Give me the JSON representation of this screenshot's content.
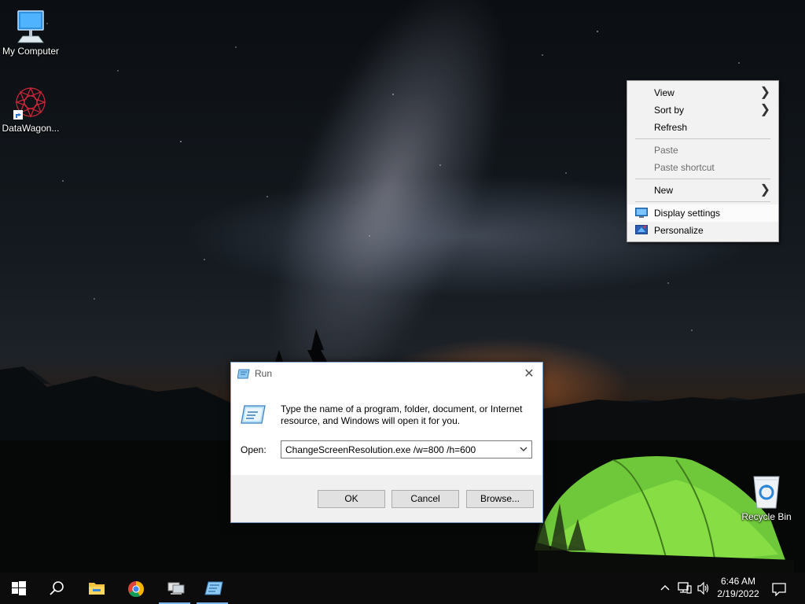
{
  "desktop": {
    "icons": [
      {
        "label": "My Computer",
        "icon": "computer-icon"
      },
      {
        "label": "DataWagon...",
        "icon": "datawagon-icon"
      },
      {
        "label": "Recycle Bin",
        "icon": "recycle-bin-icon"
      }
    ]
  },
  "context_menu": {
    "items": [
      {
        "label": "View",
        "submenu": true
      },
      {
        "label": "Sort by",
        "submenu": true
      },
      {
        "label": "Refresh"
      },
      {
        "label": "Paste",
        "disabled": true
      },
      {
        "label": "Paste shortcut",
        "disabled": true
      },
      {
        "label": "New",
        "submenu": true
      },
      {
        "label": "Display settings",
        "icon": "display-icon",
        "highlighted": true
      },
      {
        "label": "Personalize",
        "icon": "personalize-icon"
      }
    ]
  },
  "run_dialog": {
    "title": "Run",
    "close_glyph": "✕",
    "description": "Type the name of a program, folder, document, or Internet resource, and Windows will open it for you.",
    "open_label": "Open:",
    "open_value": "ChangeScreenResolution.exe /w=800 /h=600",
    "ok_label": "OK",
    "cancel_label": "Cancel",
    "browse_label": "Browse..."
  },
  "taskbar": {
    "items": [
      "start-icon",
      "search-icon",
      "file-explorer-icon",
      "chrome-icon",
      "network-app-icon",
      "run-icon"
    ],
    "clock": {
      "time": "6:46 AM",
      "date": "2/19/2022"
    },
    "accent": "#7ab4e8"
  },
  "chevron_glyph": "❯"
}
